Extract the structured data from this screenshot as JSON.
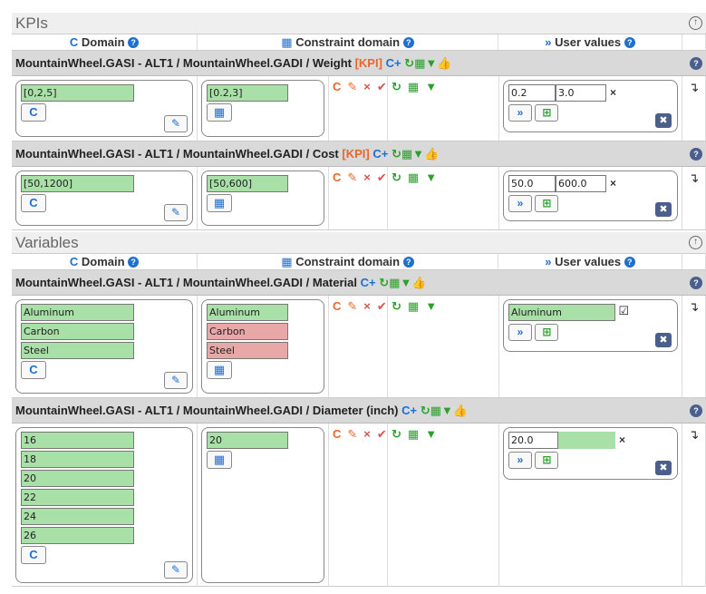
{
  "kpis_section": {
    "title": "KPIs",
    "columns": {
      "domain": "Domain",
      "constraint": "Constraint domain",
      "user_values": "User values"
    },
    "rows": [
      {
        "title": "MountainWheel.GASI - ALT1 / MountainWheel.GADI / Weight",
        "tag": "[KPI]",
        "domain": [
          "[0,2,5]"
        ],
        "constraint": [
          "[0.2,3]"
        ],
        "user_min": "0.2",
        "user_max": "3.0"
      },
      {
        "title": "MountainWheel.GASI - ALT1 / MountainWheel.GADI / Cost",
        "tag": "[KPI]",
        "domain": [
          "[50,1200]"
        ],
        "constraint": [
          "[50,600]"
        ],
        "user_min": "50.0",
        "user_max": "600.0"
      }
    ]
  },
  "variables_section": {
    "title": "Variables",
    "columns": {
      "domain": "Domain",
      "constraint": "Constraint domain",
      "user_values": "User values"
    },
    "rows": [
      {
        "title": "MountainWheel.GASI - ALT1 / MountainWheel.GADI / Material",
        "domain": [
          "Aluminum",
          "Carbon",
          "Steel"
        ],
        "constraint": [
          "Aluminum",
          "Carbon",
          "Steel"
        ],
        "user_value": "Aluminum"
      },
      {
        "title": "MountainWheel.GASI - ALT1 / MountainWheel.GADI / Diameter (inch)",
        "domain": [
          "16",
          "18",
          "20",
          "22",
          "24",
          "26"
        ],
        "constraint": [
          "20"
        ],
        "user_value": "20.0"
      }
    ]
  },
  "icons": {
    "reset": "C",
    "edit": "✎",
    "delete": "×",
    "check": "✔",
    "refresh": "↻",
    "calc": "▦",
    "filter": "▼",
    "like": "👍",
    "add": "C+",
    "help": "?",
    "arrow_down": "↴",
    "more": "»",
    "plus": "⊞",
    "close": "✖",
    "collapse": "↑"
  }
}
